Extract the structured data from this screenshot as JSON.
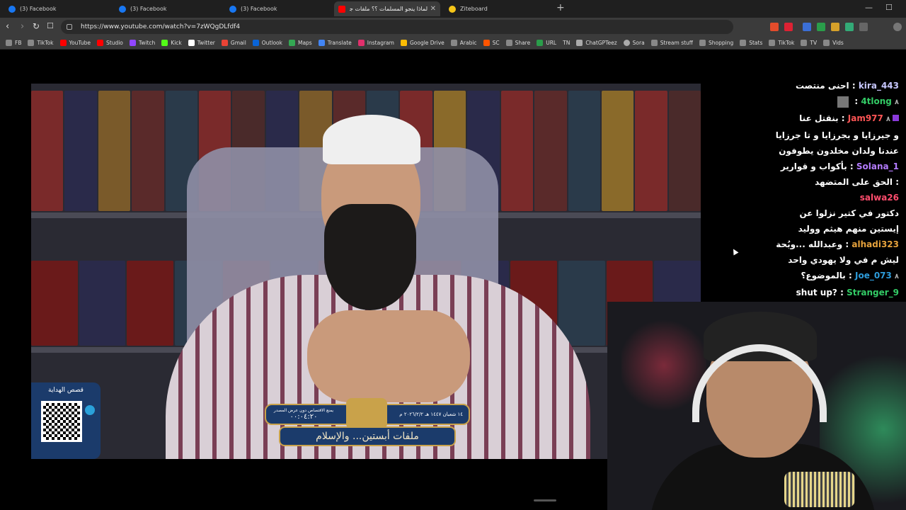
{
  "tabs": [
    {
      "label": "(3) Facebook",
      "icon": "facebook-icon"
    },
    {
      "label": "(3) Facebook",
      "icon": "facebook-icon"
    },
    {
      "label": "(3) Facebook",
      "icon": "facebook-icon"
    },
    {
      "label": "لماذا ينجو المسلمات ؟؟ ملفات جز...",
      "icon": "youtube-icon",
      "active": true
    },
    {
      "label": "Ziteboard",
      "icon": "ziteboard-icon"
    }
  ],
  "address_bar": {
    "url": "https://www.youtube.com/watch?v=7zWQgDLfdf4"
  },
  "bookmarks": [
    "FB",
    "TikTok",
    "YouTube",
    "Studio",
    "Twitch",
    "Kick",
    "Twitter",
    "Gmail",
    "Outlook",
    "Maps",
    "Translate",
    "Instagram",
    "Google Drive",
    "Arabic",
    "SC",
    "Share",
    "URL",
    "TN",
    "ChatGPTeez",
    "Sora",
    "Stream stuff",
    "Shopping",
    "Stats",
    "TikTok",
    "TV",
    "Vids"
  ],
  "video": {
    "qr_title": "قصص الهداية",
    "lower_third_date": "١٤ شعبان ١٤٤٧ هـ ٢٠٢٦/٢/٢ م",
    "lower_third_note": "يمنع الاقتصاص دون عرض المصدر",
    "lower_third_time": "٠٠:٠٤:٢٠",
    "lower_third_title": "ملفات أبستين... والإسلام"
  },
  "chat": [
    {
      "user": "kira_443",
      "text": "احنى منتصت",
      "color": "#c8c8ff"
    },
    {
      "user": "4tlong",
      "text": "",
      "color": "#33cc66",
      "badge": "٨"
    },
    {
      "user": "Jam977",
      "text": "بنقتل عنا",
      "color": "#ff5555",
      "badge": "٨"
    },
    {
      "user": "Solana_1",
      "text": "و جيرزايا و بجرزايا و تا جرزايا عندنا ولدان مخلدون يطوفون بأكواب و قوارير",
      "color": "#b47cff"
    },
    {
      "user": "salwa26",
      "text": "الحق على المتضهد",
      "color": "#ff4d6d"
    },
    {
      "user": "alhadi323",
      "text": "دكتور في كتير نزلوا عن إيستين منهم هيثم ووليد وعبدالله ...وبُحة",
      "color": "#e6a23c"
    },
    {
      "user": "Joe_073",
      "text": "ليش م في ولا يهودي واحد بالموضوع؟",
      "color": "#2d9cdb",
      "badge": "٨"
    },
    {
      "user": "Stranger_9",
      "text": "shut up?",
      "color": "#33cc66"
    }
  ],
  "colors": {
    "tabbar": "#1f1f1f",
    "toolbar": "#3b3b3b",
    "video_bg": "#000000"
  }
}
